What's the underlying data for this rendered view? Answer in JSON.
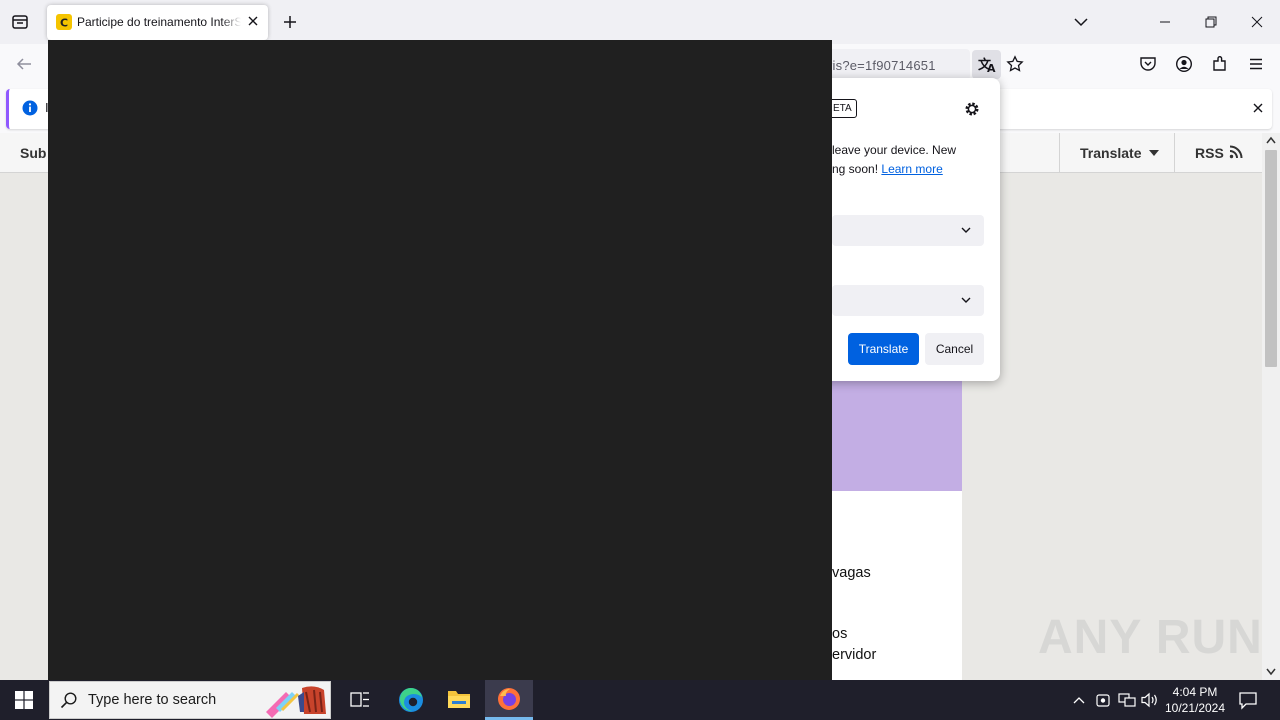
{
  "browser": {
    "tab": {
      "title": "Participe do treinamento InterS"
    },
    "url": "ris?e=1f90714651"
  },
  "site_header": {
    "left_label": "Sub",
    "translate_label": "Translate",
    "rss_label": "RSS"
  },
  "notification": {
    "text": "I"
  },
  "translation_panel": {
    "badge": "ETA",
    "desc_line1": "leave your device. New",
    "desc_line2": "ng soon!",
    "learn_more": "Learn more",
    "translate_button": "Translate",
    "cancel_button": "Cancel"
  },
  "page_content": {
    "line1": "vagas",
    "line2": "os",
    "line3": "ervidor"
  },
  "watermark": "ANY RUN",
  "taskbar": {
    "search_placeholder": "Type here to search",
    "time": "4:04 PM",
    "date": "10/21/2024"
  },
  "colors": {
    "accent": "#0061e0",
    "dark_window": "#202020",
    "purple_block": "#c3aee4",
    "taskbar": "#1f1f2b"
  }
}
